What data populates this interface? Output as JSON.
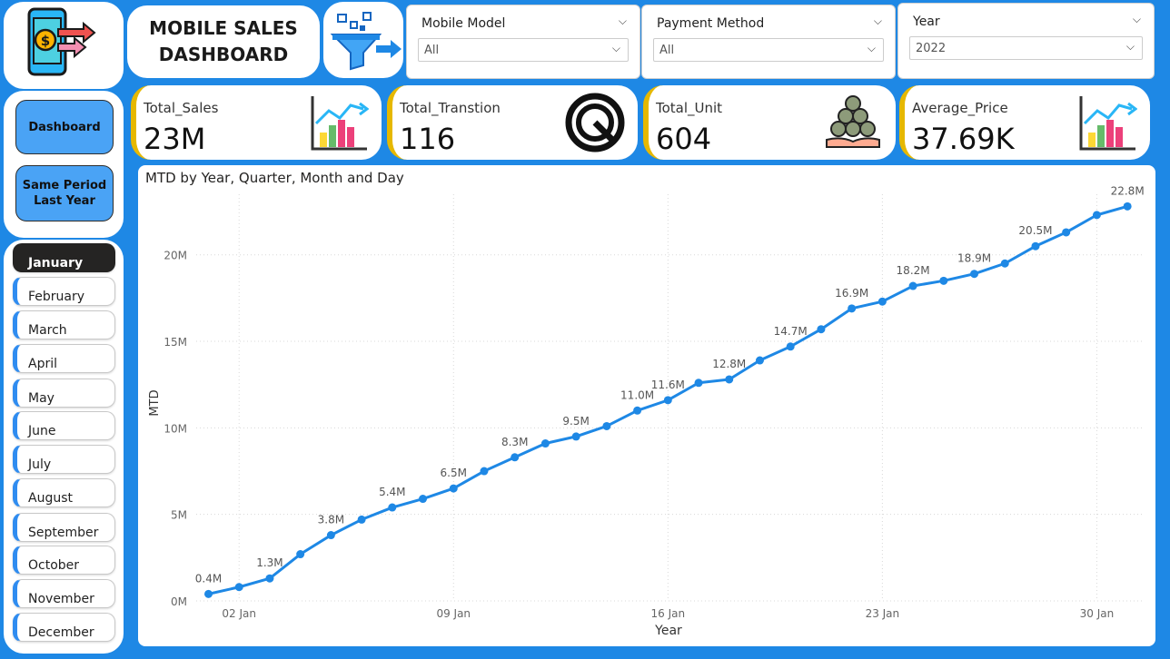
{
  "header": {
    "title": "MOBILE SALES\nDASHBOARD",
    "logo_icon": "mobile-money-transfer-icon",
    "filter_icon": "funnel-filter-icon"
  },
  "slicers": [
    {
      "label": "Mobile Model",
      "value": "All"
    },
    {
      "label": "Payment Method",
      "value": "All"
    },
    {
      "label": "Year",
      "value": "2022"
    }
  ],
  "nav": {
    "dashboard": "Dashboard",
    "same_period": "Same Period\nLast Year"
  },
  "months": [
    "January",
    "February",
    "March",
    "April",
    "May",
    "June",
    "July",
    "August",
    "September",
    "October",
    "November",
    "December"
  ],
  "active_month": "January",
  "kpis": [
    {
      "label": "Total_Sales",
      "value": "23M",
      "icon": "bar-chart-growth-icon"
    },
    {
      "label": "Total_Transtion",
      "value": "116",
      "icon": "circular-gauge-icon"
    },
    {
      "label": "Total_Unit",
      "value": "604",
      "icon": "coin-stack-hand-icon"
    },
    {
      "label": "Average_Price",
      "value": "37.69K",
      "icon": "bar-chart-growth-icon"
    }
  ],
  "colors": {
    "accent": "#1e88e5",
    "line": "#1e88e5",
    "kpi_bar": "#e6b800",
    "active_month": "#252423"
  },
  "chart_data": {
    "type": "line",
    "title": "MTD by Year, Quarter, Month and Day",
    "xlabel": "Year",
    "ylabel": "MTD",
    "ylim": [
      0,
      23500000
    ],
    "xlim": [
      0.6,
      31.5
    ],
    "grid": true,
    "y_ticks": [
      {
        "v": 0,
        "t": "0M"
      },
      {
        "v": 5000000,
        "t": "5M"
      },
      {
        "v": 10000000,
        "t": "10M"
      },
      {
        "v": 15000000,
        "t": "15M"
      },
      {
        "v": 20000000,
        "t": "20M"
      }
    ],
    "x_ticks": [
      {
        "v": 2,
        "t": "02 Jan"
      },
      {
        "v": 9,
        "t": "09 Jan"
      },
      {
        "v": 16,
        "t": "16 Jan"
      },
      {
        "v": 23,
        "t": "23 Jan"
      },
      {
        "v": 30,
        "t": "30 Jan"
      }
    ],
    "x": [
      1,
      2,
      3,
      4,
      5,
      6,
      7,
      8,
      9,
      10,
      11,
      12,
      13,
      14,
      15,
      16,
      17,
      18,
      19,
      20,
      21,
      22,
      23,
      24,
      25,
      26,
      27,
      28,
      29,
      30,
      31
    ],
    "values": [
      400000,
      800000,
      1300000,
      2700000,
      3800000,
      4700000,
      5400000,
      5900000,
      6500000,
      7500000,
      8300000,
      9100000,
      9500000,
      10100000,
      11000000,
      11600000,
      12600000,
      12800000,
      13900000,
      14700000,
      15700000,
      16900000,
      17300000,
      18200000,
      18500000,
      18900000,
      19500000,
      20500000,
      21300000,
      22300000,
      22800000
    ],
    "labels": {
      "1": "0.4M",
      "3": "1.3M",
      "5": "3.8M",
      "7": "5.4M",
      "9": "6.5M",
      "11": "8.3M",
      "13": "9.5M",
      "15": "11.0M",
      "16": "11.6M",
      "18": "12.8M",
      "20": "14.7M",
      "22": "16.9M",
      "24": "18.2M",
      "26": "18.9M",
      "28": "20.5M",
      "31": "22.8M"
    }
  }
}
